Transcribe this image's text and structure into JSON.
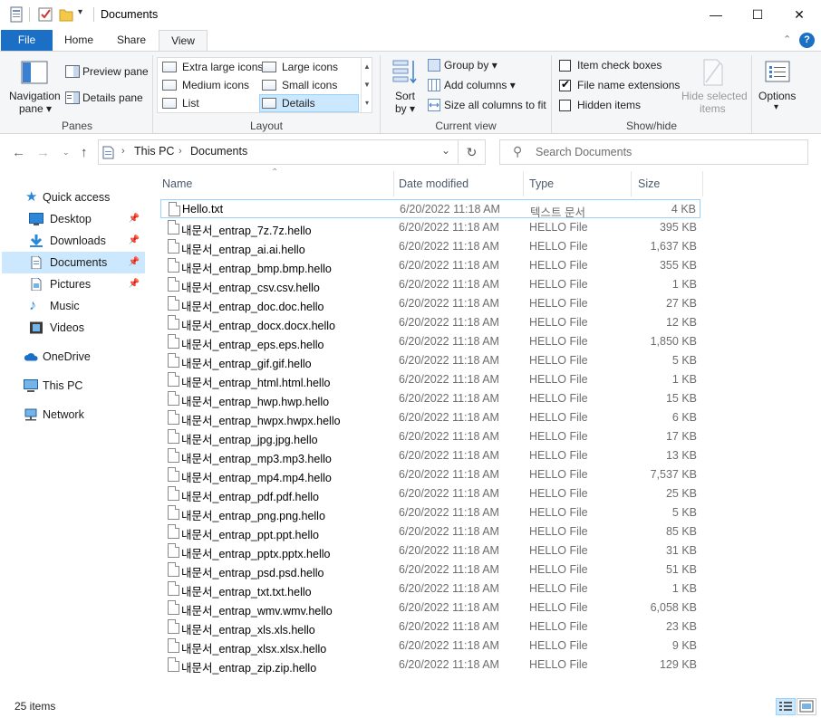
{
  "window": {
    "title": "Documents",
    "minimize": "—",
    "maximize": "☐",
    "close": "✕"
  },
  "ribbon_tabs": [
    "File",
    "Home",
    "Share",
    "View"
  ],
  "ribbon": {
    "panes": {
      "nav_pane_line1": "Navigation",
      "nav_pane_line2": "pane",
      "preview_pane": "Preview pane",
      "details_pane": "Details pane",
      "group_label": "Panes"
    },
    "layout": {
      "items": [
        "Extra large icons",
        "Large icons",
        "Medium icons",
        "Small icons",
        "List",
        "Details"
      ],
      "selected": "Details",
      "group_label": "Layout"
    },
    "current_view": {
      "sort_line1": "Sort",
      "sort_line2": "by",
      "group_by": "Group by",
      "add_columns": "Add columns",
      "size_all_columns": "Size all columns to fit",
      "group_label": "Current view"
    },
    "show_hide": {
      "item_check_boxes": "Item check boxes",
      "file_name_extensions": "File name extensions",
      "hidden_items": "Hidden items",
      "hide_selected_line1": "Hide selected",
      "hide_selected_line2": "items",
      "group_label": "Show/hide"
    },
    "options": "Options"
  },
  "address": {
    "crumbs": [
      "This PC",
      "Documents"
    ],
    "search_placeholder": "Search Documents"
  },
  "nav_pane": {
    "quick_access": "Quick access",
    "items": [
      {
        "label": "Desktop",
        "icon": "desktop-icon"
      },
      {
        "label": "Downloads",
        "icon": "downloads-icon"
      },
      {
        "label": "Documents",
        "icon": "documents-icon"
      },
      {
        "label": "Pictures",
        "icon": "pictures-icon"
      },
      {
        "label": "Music",
        "icon": "music-icon"
      },
      {
        "label": "Videos",
        "icon": "videos-icon"
      }
    ],
    "onedrive": "OneDrive",
    "this_pc": "This PC",
    "network": "Network"
  },
  "columns": {
    "name": "Name",
    "date": "Date modified",
    "type": "Type",
    "size": "Size"
  },
  "files": [
    {
      "name": "Hello.txt",
      "date": "6/20/2022 11:18 AM",
      "type": "텍스트 문서",
      "size": "4 KB"
    },
    {
      "name": "내문서_entrap_7z.7z.hello",
      "date": "6/20/2022 11:18 AM",
      "type": "HELLO File",
      "size": "395 KB"
    },
    {
      "name": "내문서_entrap_ai.ai.hello",
      "date": "6/20/2022 11:18 AM",
      "type": "HELLO File",
      "size": "1,637 KB"
    },
    {
      "name": "내문서_entrap_bmp.bmp.hello",
      "date": "6/20/2022 11:18 AM",
      "type": "HELLO File",
      "size": "355 KB"
    },
    {
      "name": "내문서_entrap_csv.csv.hello",
      "date": "6/20/2022 11:18 AM",
      "type": "HELLO File",
      "size": "1 KB"
    },
    {
      "name": "내문서_entrap_doc.doc.hello",
      "date": "6/20/2022 11:18 AM",
      "type": "HELLO File",
      "size": "27 KB"
    },
    {
      "name": "내문서_entrap_docx.docx.hello",
      "date": "6/20/2022 11:18 AM",
      "type": "HELLO File",
      "size": "12 KB"
    },
    {
      "name": "내문서_entrap_eps.eps.hello",
      "date": "6/20/2022 11:18 AM",
      "type": "HELLO File",
      "size": "1,850 KB"
    },
    {
      "name": "내문서_entrap_gif.gif.hello",
      "date": "6/20/2022 11:18 AM",
      "type": "HELLO File",
      "size": "5 KB"
    },
    {
      "name": "내문서_entrap_html.html.hello",
      "date": "6/20/2022 11:18 AM",
      "type": "HELLO File",
      "size": "1 KB"
    },
    {
      "name": "내문서_entrap_hwp.hwp.hello",
      "date": "6/20/2022 11:18 AM",
      "type": "HELLO File",
      "size": "15 KB"
    },
    {
      "name": "내문서_entrap_hwpx.hwpx.hello",
      "date": "6/20/2022 11:18 AM",
      "type": "HELLO File",
      "size": "6 KB"
    },
    {
      "name": "내문서_entrap_jpg.jpg.hello",
      "date": "6/20/2022 11:18 AM",
      "type": "HELLO File",
      "size": "17 KB"
    },
    {
      "name": "내문서_entrap_mp3.mp3.hello",
      "date": "6/20/2022 11:18 AM",
      "type": "HELLO File",
      "size": "13 KB"
    },
    {
      "name": "내문서_entrap_mp4.mp4.hello",
      "date": "6/20/2022 11:18 AM",
      "type": "HELLO File",
      "size": "7,537 KB"
    },
    {
      "name": "내문서_entrap_pdf.pdf.hello",
      "date": "6/20/2022 11:18 AM",
      "type": "HELLO File",
      "size": "25 KB"
    },
    {
      "name": "내문서_entrap_png.png.hello",
      "date": "6/20/2022 11:18 AM",
      "type": "HELLO File",
      "size": "5 KB"
    },
    {
      "name": "내문서_entrap_ppt.ppt.hello",
      "date": "6/20/2022 11:18 AM",
      "type": "HELLO File",
      "size": "85 KB"
    },
    {
      "name": "내문서_entrap_pptx.pptx.hello",
      "date": "6/20/2022 11:18 AM",
      "type": "HELLO File",
      "size": "31 KB"
    },
    {
      "name": "내문서_entrap_psd.psd.hello",
      "date": "6/20/2022 11:18 AM",
      "type": "HELLO File",
      "size": "51 KB"
    },
    {
      "name": "내문서_entrap_txt.txt.hello",
      "date": "6/20/2022 11:18 AM",
      "type": "HELLO File",
      "size": "1 KB"
    },
    {
      "name": "내문서_entrap_wmv.wmv.hello",
      "date": "6/20/2022 11:18 AM",
      "type": "HELLO File",
      "size": "6,058 KB"
    },
    {
      "name": "내문서_entrap_xls.xls.hello",
      "date": "6/20/2022 11:18 AM",
      "type": "HELLO File",
      "size": "23 KB"
    },
    {
      "name": "내문서_entrap_xlsx.xlsx.hello",
      "date": "6/20/2022 11:18 AM",
      "type": "HELLO File",
      "size": "9 KB"
    },
    {
      "name": "내문서_entrap_zip.zip.hello",
      "date": "6/20/2022 11:18 AM",
      "type": "HELLO File",
      "size": "129 KB"
    }
  ],
  "status": {
    "item_count": "25 items"
  },
  "colors": {
    "accent": "#1b6fc5",
    "selection": "#cce8ff",
    "selection_border": "#99d1ff"
  }
}
